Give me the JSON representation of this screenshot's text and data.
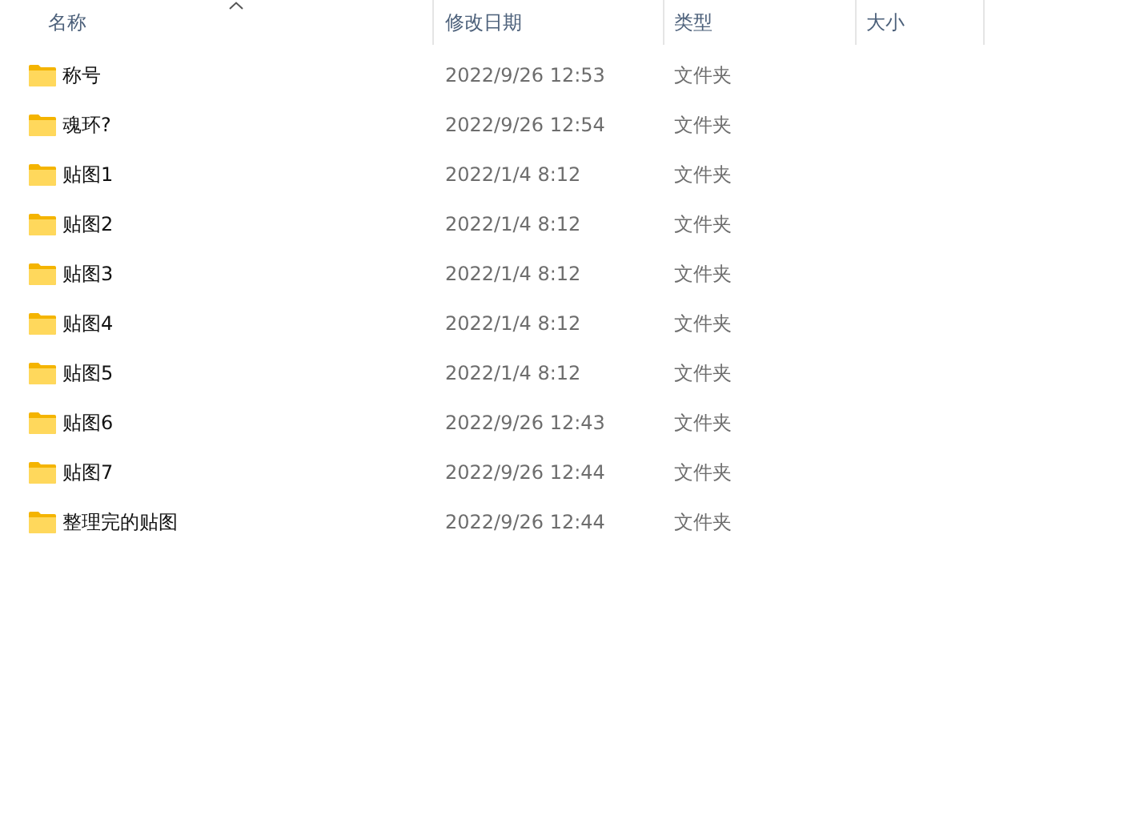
{
  "columns": [
    {
      "label": "名称",
      "sorted": true
    },
    {
      "label": "修改日期",
      "sorted": false
    },
    {
      "label": "类型",
      "sorted": false
    },
    {
      "label": "大小",
      "sorted": false
    }
  ],
  "rows": [
    {
      "name": "称号",
      "modified": "2022/9/26 12:53",
      "type": "文件夹"
    },
    {
      "name": "魂环?",
      "modified": "2022/9/26 12:54",
      "type": "文件夹"
    },
    {
      "name": "贴图1",
      "modified": "2022/1/4 8:12",
      "type": "文件夹"
    },
    {
      "name": "贴图2",
      "modified": "2022/1/4 8:12",
      "type": "文件夹"
    },
    {
      "name": "贴图3",
      "modified": "2022/1/4 8:12",
      "type": "文件夹"
    },
    {
      "name": "贴图4",
      "modified": "2022/1/4 8:12",
      "type": "文件夹"
    },
    {
      "name": "贴图5",
      "modified": "2022/1/4 8:12",
      "type": "文件夹"
    },
    {
      "name": "贴图6",
      "modified": "2022/9/26 12:43",
      "type": "文件夹"
    },
    {
      "name": "贴图7",
      "modified": "2022/9/26 12:44",
      "type": "文件夹"
    },
    {
      "name": "整理完的贴图",
      "modified": "2022/9/26 12:44",
      "type": "文件夹"
    }
  ]
}
